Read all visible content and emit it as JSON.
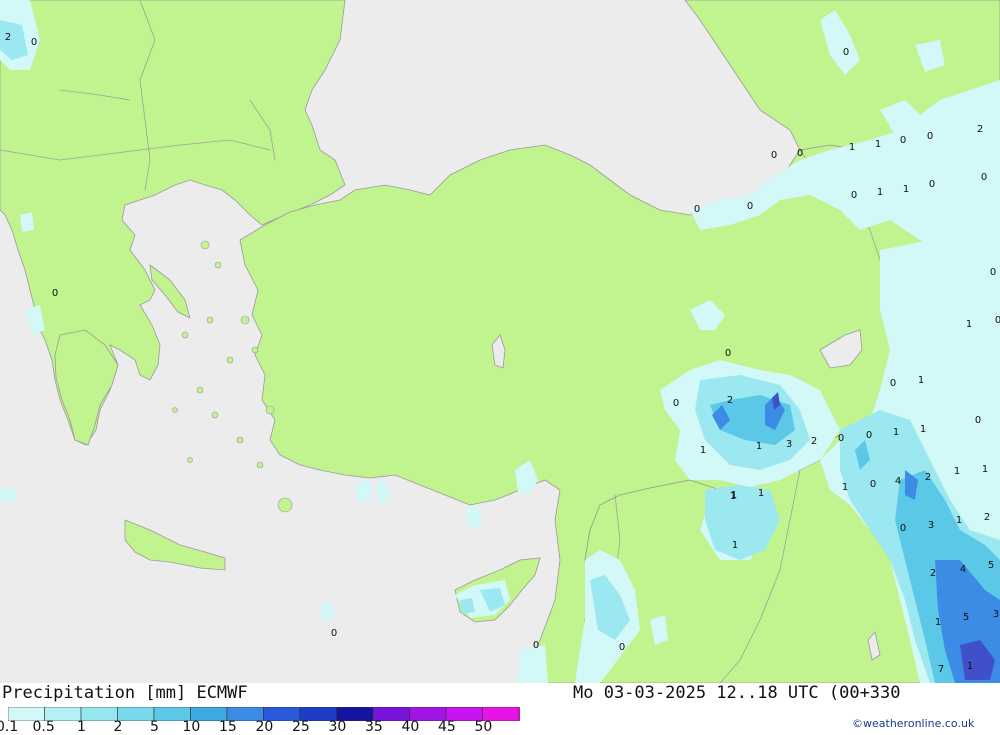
{
  "title": "Precipitation [mm] ECMWF",
  "datetime": "Mo 03-03-2025 12..18 UTC (00+330",
  "credit": "©weatheronline.co.uk",
  "colors": {
    "sea": "#ececec",
    "land": "#c1f38e",
    "border": "#a0a0a0",
    "precip_light": "#d2f8f8",
    "precip_mid": "#9ce8f0",
    "precip_high": "#5ac8e6",
    "precip_heavy": "#3c8ce6",
    "precip_max": "#4050c8"
  },
  "legend": {
    "ticks": [
      "0.1",
      "0.5",
      "1",
      "2",
      "5",
      "10",
      "15",
      "20",
      "25",
      "30",
      "35",
      "40",
      "45",
      "50"
    ],
    "swatches": [
      "#d2f8f8",
      "#b4f0f4",
      "#96e6f0",
      "#78d8ec",
      "#5ac8e6",
      "#3caae0",
      "#3c8ce6",
      "#2a5adc",
      "#1e3cc8",
      "#1414a0",
      "#7814dc",
      "#a014e6",
      "#c814f0",
      "#e614e6",
      "#be14be"
    ]
  },
  "map_labels": [
    "2",
    "0",
    "0",
    "2",
    "0",
    "0",
    "1",
    "1",
    "0",
    "0",
    "1",
    "1",
    "0",
    "0",
    "0",
    "0",
    "0",
    "0",
    "1",
    "0",
    "0",
    "0",
    "2",
    "1",
    "0",
    "1",
    "3",
    "2",
    "0",
    "0",
    "1",
    "1",
    "0",
    "1",
    "1",
    "4",
    "2",
    "0",
    "1",
    "1",
    "1",
    "0",
    "3",
    "1",
    "2",
    "1",
    "2",
    "4",
    "5",
    "1",
    "1",
    "1",
    "5",
    "3",
    "0",
    "0",
    "0",
    "0",
    "7",
    "1"
  ]
}
